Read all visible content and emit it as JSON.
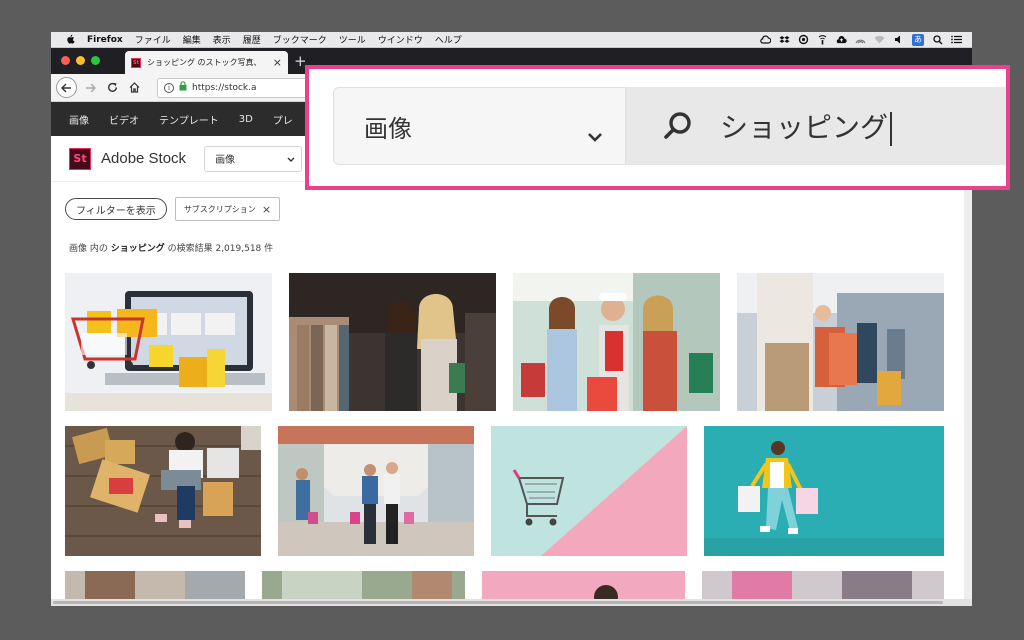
{
  "menubar": {
    "app_name": "Firefox",
    "items": [
      "ファイル",
      "編集",
      "表示",
      "履歴",
      "ブックマーク",
      "ツール",
      "ウインドウ",
      "ヘルプ"
    ],
    "status_icons": [
      "creative-cloud-icon",
      "dropbox-icon",
      "sync-icon",
      "wifi-status-icon",
      "cloud-upload-icon",
      "airdrop-icon",
      "wifi-icon",
      "volume-icon"
    ],
    "ime_label": "あ"
  },
  "browser": {
    "tab_title": "ショッピング のストック写真、",
    "tab_close": "×",
    "new_tab": "+",
    "url": "https://stock.a",
    "favicon_label": "St",
    "traffic_colors": [
      "#fd5f57",
      "#febc2e",
      "#28c840"
    ]
  },
  "site": {
    "nav_items": [
      "画像",
      "ビデオ",
      "テンプレート",
      "3D",
      "プレ"
    ],
    "logo_label": "St",
    "brand": "Adobe Stock",
    "category_select": "画像",
    "filter_button": "フィルターを表示",
    "subscription_chip": "サブスクリプション",
    "chip_close": "×",
    "results": {
      "prefix": "画像 内の ",
      "query": "ショッピング",
      "suffix": " の検索結果 2,019,518 件"
    }
  },
  "callout": {
    "category": "画像",
    "query": "ショッピング",
    "border_color": "#e8418e"
  },
  "images": [
    "shopping-carts-laptop-image",
    "women-shopping-clothes-image",
    "friends-shopping-bags-image",
    "woman-bags-mall-image",
    "online-shopping-parcels-image",
    "mall-walking-couple-image",
    "cart-pastel-image",
    "woman-running-bags-image",
    "bottom-row-image-1",
    "bottom-row-image-2",
    "bottom-row-image-3",
    "bottom-row-image-4"
  ]
}
